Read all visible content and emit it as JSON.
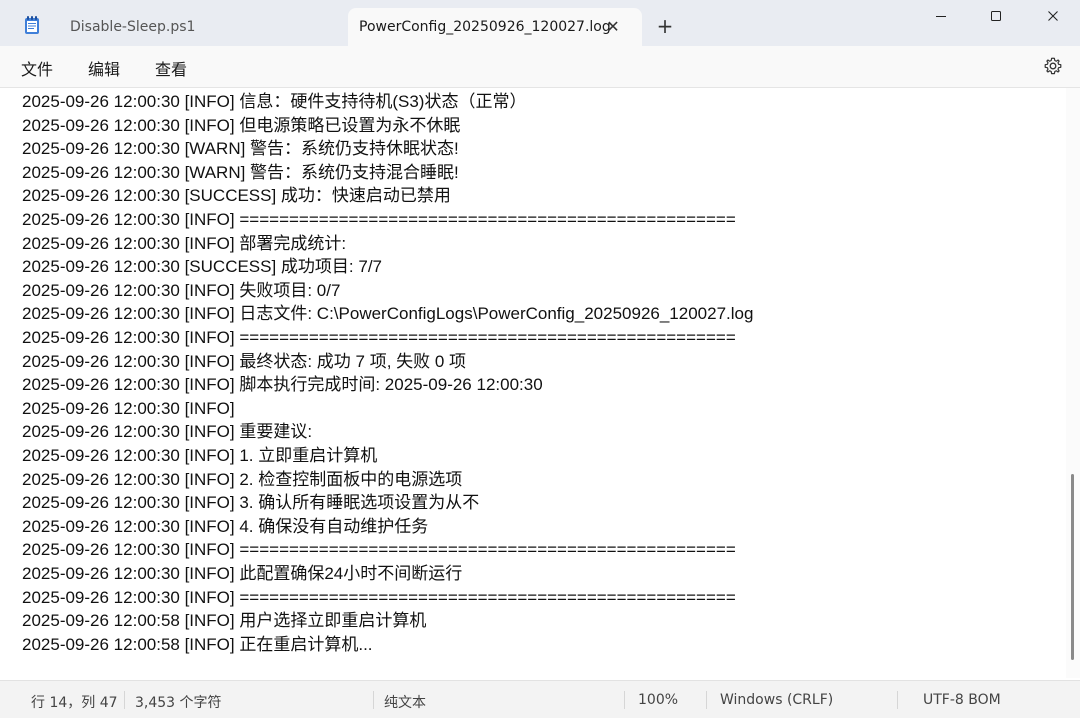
{
  "tabs": [
    {
      "label": "Disable-Sleep.ps1",
      "active": false
    },
    {
      "label": "PowerConfig_20250926_120027.log",
      "active": true
    }
  ],
  "tab_close_glyph": "✕",
  "new_tab_glyph": "+",
  "window_controls": {
    "minimize": "—",
    "maximize": "☐",
    "close": "✕"
  },
  "menu": {
    "file": "文件",
    "edit": "编辑",
    "view": "查看"
  },
  "lines": [
    "2025-09-26 12:00:30 [INFO] 信息：硬件支持待机(S3)状态（正常）",
    "2025-09-26 12:00:30 [INFO] 但电源策略已设置为永不休眠",
    "2025-09-26 12:00:30 [WARN] 警告：系统仍支持休眠状态!",
    "2025-09-26 12:00:30 [WARN] 警告：系统仍支持混合睡眠!",
    "2025-09-26 12:00:30 [SUCCESS] 成功：快速启动已禁用",
    "2025-09-26 12:00:30 [INFO] ==================================================",
    "2025-09-26 12:00:30 [INFO] 部署完成统计:",
    "2025-09-26 12:00:30 [SUCCESS] 成功项目: 7/7",
    "2025-09-26 12:00:30 [INFO] 失败项目: 0/7",
    "2025-09-26 12:00:30 [INFO] 日志文件: C:\\PowerConfigLogs\\PowerConfig_20250926_120027.log",
    "2025-09-26 12:00:30 [INFO] ==================================================",
    "2025-09-26 12:00:30 [INFO] 最终状态: 成功 7 项, 失败 0 项",
    "2025-09-26 12:00:30 [INFO] 脚本执行完成时间: 2025-09-26 12:00:30",
    "2025-09-26 12:00:30 [INFO]",
    "2025-09-26 12:00:30 [INFO] 重要建议:",
    "2025-09-26 12:00:30 [INFO] 1. 立即重启计算机",
    "2025-09-26 12:00:30 [INFO] 2. 检查控制面板中的电源选项",
    "2025-09-26 12:00:30 [INFO] 3. 确认所有睡眠选项设置为从不",
    "2025-09-26 12:00:30 [INFO] 4. 确保没有自动维护任务",
    "2025-09-26 12:00:30 [INFO] ==================================================",
    "2025-09-26 12:00:30 [INFO] 此配置确保24小时不间断运行",
    "2025-09-26 12:00:30 [INFO] ==================================================",
    "2025-09-26 12:00:58 [INFO] 用户选择立即重启计算机",
    "2025-09-26 12:00:58 [INFO] 正在重启计算机..."
  ],
  "status": {
    "position": "行 14，列 47",
    "char_count": "3,453 个字符",
    "format": "纯文本",
    "zoom": "100%",
    "line_ending": "Windows (CRLF)",
    "encoding": "UTF-8 BOM"
  }
}
